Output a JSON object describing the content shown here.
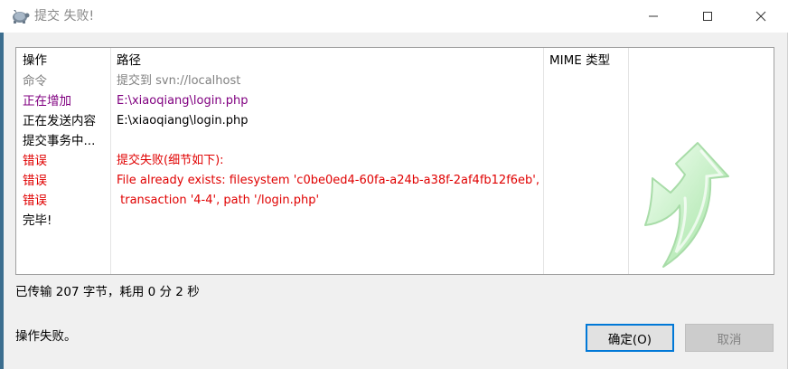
{
  "window": {
    "title": "提交 失败!"
  },
  "list": {
    "headers": {
      "action": "操作",
      "path": "路径",
      "mime": "MIME 类型"
    },
    "rows": [
      {
        "action": "命令",
        "path": "提交到 svn://localhost",
        "color": "#808080"
      },
      {
        "action": "正在增加",
        "path": "E:\\xiaoqiang\\login.php",
        "color": "#800080"
      },
      {
        "action": "正在发送内容",
        "path": "E:\\xiaoqiang\\login.php",
        "color": "#000000"
      },
      {
        "action": "提交事务中...",
        "path": "",
        "color": "#000000"
      },
      {
        "action": "错误",
        "path": "提交失败(细节如下):",
        "color": "#e00000"
      },
      {
        "action": "错误",
        "path": "File already exists: filesystem 'c0be0ed4-60fa-a24b-a38f-2af4fb12f6eb',",
        "color": "#e00000"
      },
      {
        "action": "错误",
        "path": " transaction '4-4', path '/login.php'",
        "color": "#e00000"
      },
      {
        "action": "完毕!",
        "path": "",
        "color": "#000000"
      }
    ]
  },
  "status": {
    "transfer": "已传输 207 字节，耗用 0 分 2 秒",
    "result": "操作失败。"
  },
  "buttons": {
    "ok": "确定(O)",
    "cancel": "取消"
  },
  "icons": {
    "app": "tortoise-icon",
    "arrow": "commit-arrow-icon"
  }
}
